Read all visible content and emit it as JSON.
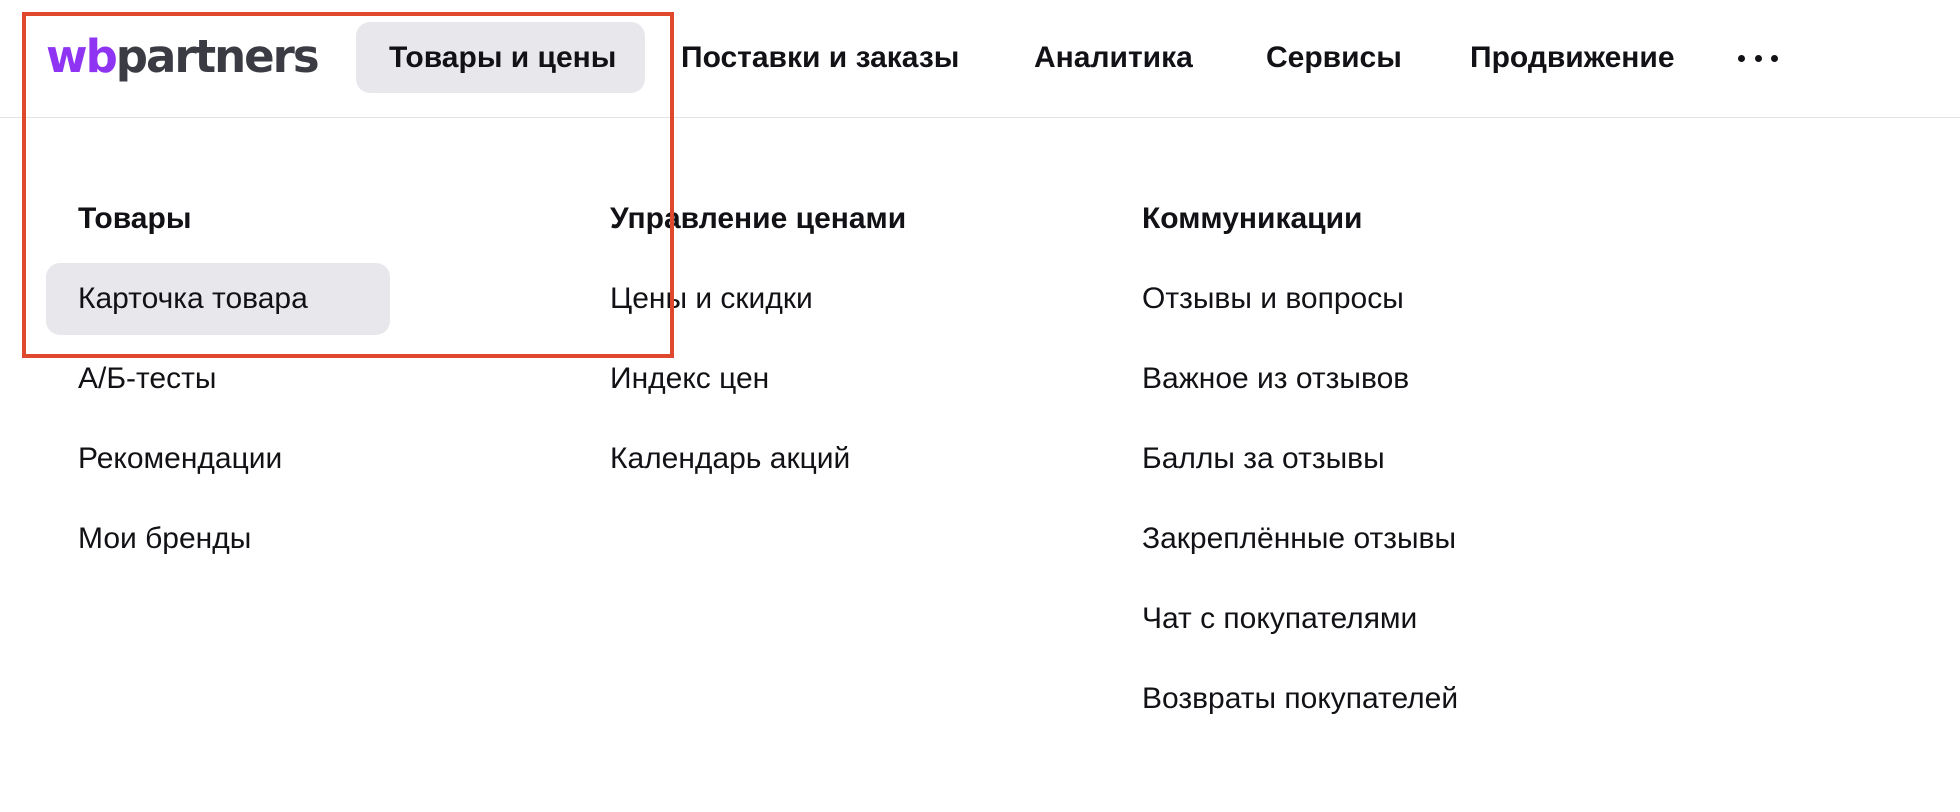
{
  "header": {
    "logo": {
      "part1": "wb",
      "part2": "partners"
    },
    "nav": [
      {
        "label": "Товары и цены",
        "active": true
      },
      {
        "label": "Поставки и заказы",
        "active": false
      },
      {
        "label": "Аналитика",
        "active": false
      },
      {
        "label": "Сервисы",
        "active": false
      },
      {
        "label": "Продвижение",
        "active": false
      }
    ],
    "more_icon": "more-horizontal-icon"
  },
  "menu": {
    "columns": [
      {
        "heading": "Товары",
        "items": [
          {
            "label": "Карточка товара",
            "active": true
          },
          {
            "label": "А/Б-тесты",
            "active": false
          },
          {
            "label": "Рекомендации",
            "active": false
          },
          {
            "label": "Мои бренды",
            "active": false
          }
        ]
      },
      {
        "heading": "Управление ценами",
        "items": [
          {
            "label": "Цены и скидки",
            "active": false
          },
          {
            "label": "Индекс цен",
            "active": false
          },
          {
            "label": "Календарь акций",
            "active": false
          }
        ]
      },
      {
        "heading": "Коммуникации",
        "items": [
          {
            "label": "Отзывы и вопросы",
            "active": false
          },
          {
            "label": "Важное из отзывов",
            "active": false
          },
          {
            "label": "Баллы за отзывы",
            "active": false
          },
          {
            "label": "Закреплённые отзывы",
            "active": false
          },
          {
            "label": "Чат с покупателями",
            "active": false
          },
          {
            "label": "Возвраты покупателей",
            "active": false
          }
        ]
      }
    ]
  },
  "colors": {
    "brand_purple": "#8e34f2",
    "active_background": "#e8e8ec",
    "highlight_frame": "#e0482e"
  }
}
